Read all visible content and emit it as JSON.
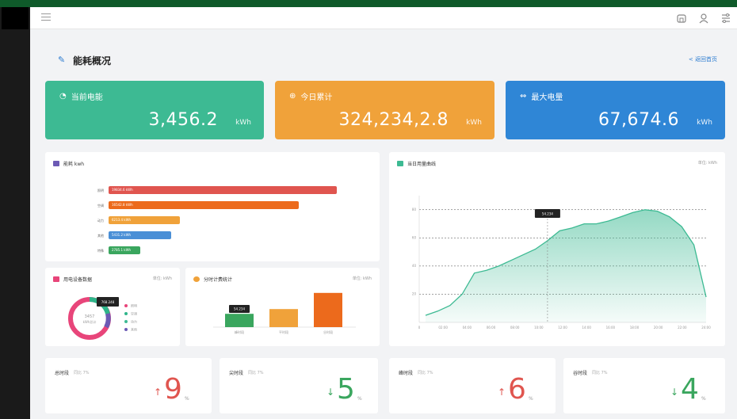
{
  "header": {
    "title": "能耗概况",
    "back_label": "< 返回首页"
  },
  "stats": [
    {
      "label": "当前电能",
      "value": "3,456.2",
      "unit": "kWh",
      "color": "#3dba93"
    },
    {
      "label": "今日累计",
      "value": "324,234,2.8",
      "unit": "kWh",
      "color": "#f0a23a"
    },
    {
      "label": "最大电量",
      "value": "67,674.6",
      "unit": "kWh",
      "color": "#2f86d6"
    }
  ],
  "energy_chart": {
    "title": "能耗 kwh",
    "chart_data": {
      "type": "bar",
      "categories": [
        "照明",
        "空调",
        "动力",
        "其他",
        "特殊"
      ],
      "values": [
        19834.6,
        16542.8,
        6213.4,
        5431.2,
        2785.1
      ],
      "labels": [
        "19834.6 kWh",
        "16542.8 kWh",
        "6213.4 kWh",
        "5431.2 kWh",
        "2785.1 kWh"
      ],
      "colors": [
        "#e0554f",
        "#ec6a1c",
        "#f0a23a",
        "#4a8fd6",
        "#3aa65e"
      ]
    }
  },
  "curve_chart": {
    "title": "当日用量曲线",
    "unit": "单位: kWh",
    "tooltip": "54.234",
    "chart_data": {
      "type": "area",
      "y_ticks": [
        "80",
        "60",
        "40",
        "20"
      ],
      "x": [
        "0",
        "02:00",
        "04:00",
        "06:00",
        "08:00",
        "10:00",
        "12:00",
        "14:00",
        "16:00",
        "18:00",
        "20:00",
        "22:00",
        "24:00"
      ],
      "values": [
        5,
        8,
        12,
        20,
        35,
        37,
        40,
        44,
        48,
        52,
        58,
        65,
        67,
        70,
        70,
        72,
        75,
        78,
        80,
        79,
        75,
        68,
        55,
        18
      ],
      "color": "#3dba93"
    }
  },
  "donut_card": {
    "title": "用电设备数据",
    "unit": "单位: kWh",
    "center_value": "3457",
    "center_sub": "kWh总计",
    "tooltip": "768.248",
    "legend": [
      {
        "name": "照明",
        "color": "#e8457a"
      },
      {
        "name": "空调",
        "color": "#2fb58a"
      },
      {
        "name": "动力",
        "color": "#3dba93"
      },
      {
        "name": "其他",
        "color": "#6c5ab5"
      }
    ]
  },
  "time_card": {
    "title": "分时计费统计",
    "unit": "单位: kWh",
    "tooltip": "54.234",
    "chart_data": {
      "type": "bar",
      "categories": [
        "峰时段",
        "平时段",
        "谷时段"
      ],
      "values": [
        14,
        19,
        36
      ],
      "colors": [
        "#3aa65e",
        "#f0a23a",
        "#ec6a1c"
      ]
    }
  },
  "tiles": [
    {
      "label": "总时段",
      "sub": "同比 7%",
      "value": "9",
      "trend": "up",
      "color": "#e0554f"
    },
    {
      "label": "尖时段",
      "sub": "同比 7%",
      "value": "5",
      "trend": "down",
      "color": "#3aa65e"
    },
    {
      "label": "峰时段",
      "sub": "同比 7%",
      "value": "6",
      "trend": "up",
      "color": "#e0554f"
    },
    {
      "label": "谷时段",
      "sub": "同比 7%",
      "value": "4",
      "trend": "down",
      "color": "#3aa65e"
    }
  ]
}
